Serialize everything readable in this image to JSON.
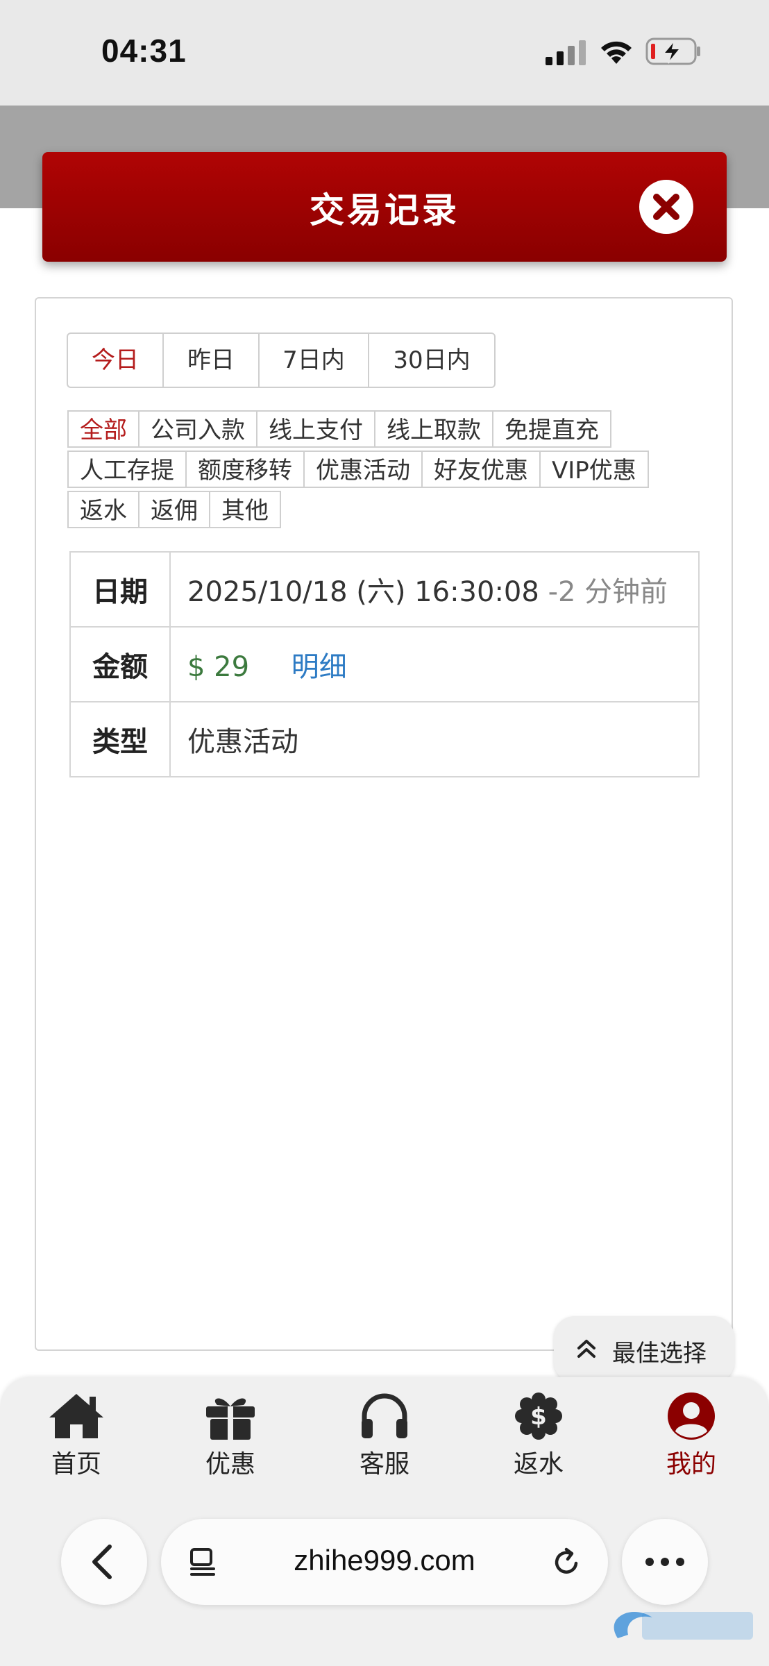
{
  "status_bar": {
    "time": "04:31"
  },
  "header": {
    "title": "交易记录"
  },
  "day_tabs": [
    {
      "label": "今日",
      "active": true
    },
    {
      "label": "昨日",
      "active": false
    },
    {
      "label": "7日内",
      "active": false
    },
    {
      "label": "30日内",
      "active": false
    }
  ],
  "filter_rows": [
    [
      {
        "label": "全部",
        "active": true
      },
      {
        "label": "公司入款"
      },
      {
        "label": "线上支付"
      },
      {
        "label": "线上取款"
      },
      {
        "label": "免提直充"
      }
    ],
    [
      {
        "label": "人工存提"
      },
      {
        "label": "额度移转"
      },
      {
        "label": "优惠活动"
      },
      {
        "label": "好友优惠"
      },
      {
        "label": "VIP优惠"
      }
    ],
    [
      {
        "label": "返水"
      },
      {
        "label": "返佣"
      },
      {
        "label": "其他"
      }
    ]
  ],
  "record": {
    "date_label": "日期",
    "date_value": "2025/10/18 (六) 16:30:08",
    "date_ago": "-2 分钟前",
    "amount_label": "金额",
    "amount_value": "$ 29",
    "detail_link": "明细",
    "type_label": "类型",
    "type_value": "优惠活动"
  },
  "floating": {
    "label": "最佳选择"
  },
  "bottom_nav": [
    {
      "label": "首页",
      "icon": "home-icon"
    },
    {
      "label": "优惠",
      "icon": "gift-icon"
    },
    {
      "label": "客服",
      "icon": "headset-icon"
    },
    {
      "label": "返水",
      "icon": "dollar-badge-icon"
    },
    {
      "label": "我的",
      "icon": "user-circle-icon",
      "active": true
    }
  ],
  "browser": {
    "url": "zhihe999.com"
  },
  "colors": {
    "header_red": "#9c0202",
    "active_red": "#b41c1c",
    "amount_green": "#3c7a3e",
    "link_blue": "#2d7bc4"
  }
}
